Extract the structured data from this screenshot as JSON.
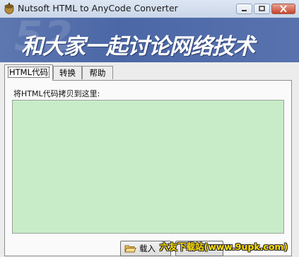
{
  "window": {
    "title": "Nutsoft HTML to AnyCode Converter",
    "icon": "nut-app-icon",
    "controls": {
      "minimize": "minimize-icon",
      "maximize": "maximize-icon",
      "close": "close-icon"
    }
  },
  "banner": {
    "watermark": "52",
    "slogan": "和大家一起讨论网络技术"
  },
  "tabs": [
    {
      "label": "HTML代码",
      "active": true
    },
    {
      "label": "转换",
      "active": false
    },
    {
      "label": "帮助",
      "active": false
    }
  ],
  "panel": {
    "prompt": "将HTML代码拷贝到这里:",
    "code_value": "",
    "load_button_label": "载入",
    "load_icon": "open-folder-icon"
  },
  "site_watermark": "六友下载站(www.9upk.com)",
  "colors": {
    "banner": "#4b67a6",
    "code_background": "#c8ecc8",
    "close_button": "#c7442c",
    "watermark_text": "#ffde00"
  }
}
